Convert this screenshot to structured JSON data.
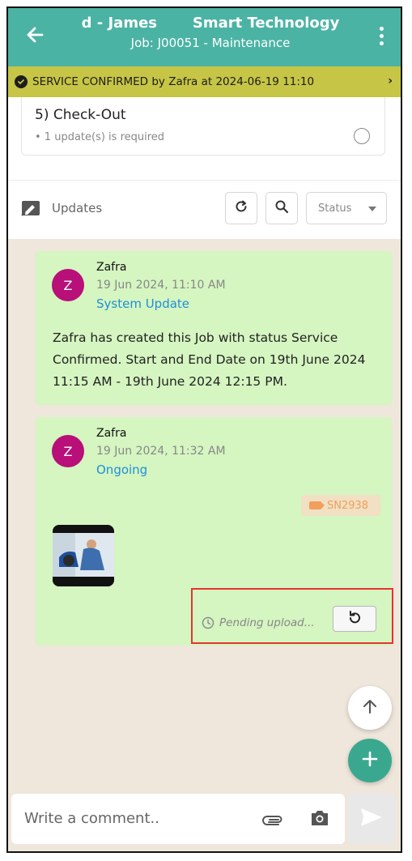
{
  "header": {
    "title": "d - James       Smart Technology",
    "subtitle": "Job: J00051 - Maintenance",
    "color": "#4bb3a4"
  },
  "banner": {
    "text": "SERVICE CONFIRMED by Zafra at 2024-06-19 11:10",
    "color": "#c6c546"
  },
  "checkout": {
    "title": "5) Check-Out",
    "subtitle": "• 1 update(s) is required"
  },
  "updates_bar": {
    "label": "Updates",
    "status_placeholder": "Status"
  },
  "feed": [
    {
      "avatar_letter": "Z",
      "name": "Zafra",
      "datetime": "19 Jun 2024, 11:10 AM",
      "type": "System Update",
      "body": "Zafra has created this Job with status Service Confirmed. Start and End Date on 19th June 2024 11:15 AM - 19th June 2024 12:15 PM."
    },
    {
      "avatar_letter": "Z",
      "name": "Zafra",
      "datetime": "19 Jun 2024, 11:32 AM",
      "type": "Ongoing",
      "tag": "SN2938",
      "pending_text": "Pending upload..."
    }
  ],
  "composer": {
    "placeholder": "Write a comment.."
  },
  "colors": {
    "card_bg": "#d5f5c1",
    "avatar": "#b80f78",
    "link_blue": "#1f8fd8",
    "fab_green": "#3aa88f",
    "highlight_red": "#e5342f"
  },
  "icons": [
    "back-arrow-icon",
    "more-vert-icon",
    "check-circle-icon",
    "chevron-right-icon",
    "radio-circle-icon",
    "updates-icon",
    "refresh-icon",
    "search-icon",
    "caret-down-icon",
    "tag-icon",
    "clock-icon",
    "retry-icon",
    "arrow-up-icon",
    "plus-icon",
    "attach-icon",
    "camera-icon",
    "send-icon"
  ]
}
